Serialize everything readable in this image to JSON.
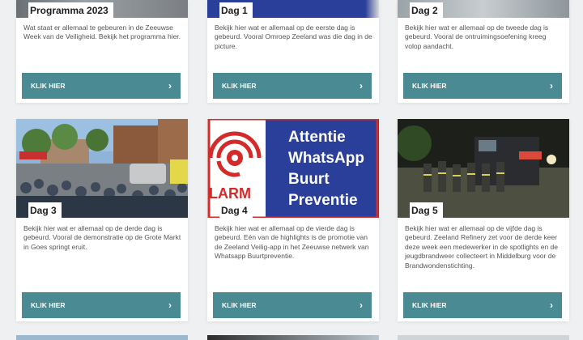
{
  "cards": [
    {
      "title": "Programma 2023",
      "desc": "Wat staat er allemaal te gebeuren in de Zeeuwse Week van de Veiligheid. Bekijk het programma hier.",
      "button": "KLIK HIER",
      "chevron": "›"
    },
    {
      "title": "Dag 1",
      "desc": "Bekijk hier wat er allemaal op de eerste dag is gebeurd. Vooral Omroep Zeeland was die dag in de picture.",
      "button": "KLIK HIER",
      "chevron": "›"
    },
    {
      "title": "Dag 2",
      "desc": "Bekijk hier wat er allemaal op de tweede dag is gebeurd. Vooral de ontruimingsoefening kreeg volop aandacht.",
      "button": "KLIK HIER",
      "chevron": "›"
    },
    {
      "title": "Dag 3",
      "desc": "Bekijk hier wat er allemaal op de derde dag is gebeurd. Vooral de demonstratie op de Grote Markt in Goes springt eruit.",
      "button": "KLIK HIER",
      "chevron": "›"
    },
    {
      "title": "Dag 4",
      "desc": "Bekijk hier wat er allemaal op de vierde dag is gebeurd. Eén van de highlights is de promotie van de Zeeland Veilig-app in het Zeeuwse netwerk van Whatsapp Buurtpreventie.",
      "button": "KLIK HIER",
      "chevron": "›",
      "sign": {
        "line1": "Attentie",
        "line2": "WhatsApp",
        "line3": "Buurt",
        "line4": "Preventie",
        "alarm": "LARM"
      }
    },
    {
      "title": "Dag 5",
      "desc": "Bekijk hier wat er allemaal op de vijfde dag is gebeurd. Zeeland Refinery zet voor de derde keer deze week een medewerker in de spotlights en de jeugdbrandweer collecteert in Middelburg voor de Brandwondenstichting.",
      "button": "KLIK HIER",
      "chevron": "›"
    }
  ],
  "colors": {
    "button": "#4a8a92",
    "background": "#eef0f1",
    "sign_blue": "#2a3f9a",
    "sign_red": "#d42a2a"
  }
}
